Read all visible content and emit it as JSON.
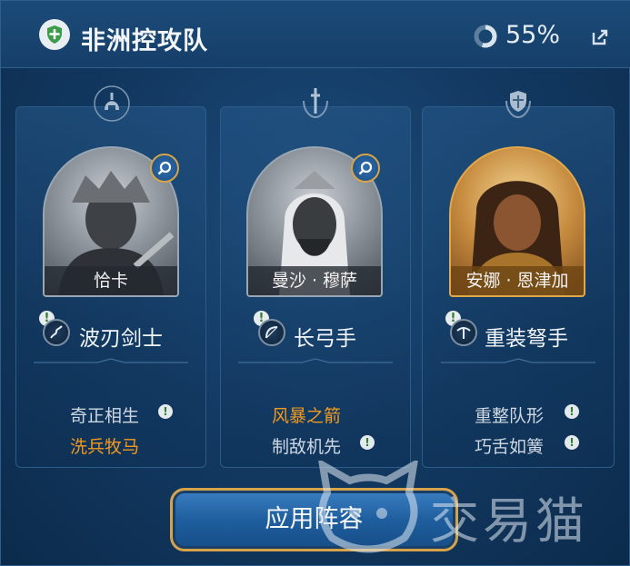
{
  "header": {
    "team_name": "非洲控攻队",
    "progress_text": "55%",
    "progress_fraction": 0.55
  },
  "cards": [
    {
      "hero_name": "恰卡",
      "class_label": "波刃剑士",
      "role_icon": "spartan-helmet-icon",
      "class_icon": "wavy-sword-icon",
      "portrait_style": "grayscale",
      "skills": [
        {
          "text": "奇正相生",
          "color": "white",
          "has_warn": true
        },
        {
          "text": "洗兵牧马",
          "color": "orange",
          "has_warn": false
        }
      ]
    },
    {
      "hero_name": "曼沙 · 穆萨",
      "class_label": "长弓手",
      "role_icon": "sword-wreath-icon",
      "class_icon": "bow-icon",
      "portrait_style": "grayscale",
      "skills": [
        {
          "text": "风暴之箭",
          "color": "orange",
          "has_warn": false
        },
        {
          "text": "制敌机先",
          "color": "white",
          "has_warn": true
        }
      ]
    },
    {
      "hero_name": "安娜 · 恩津加",
      "class_label": "重装弩手",
      "role_icon": "shield-wreath-icon",
      "class_icon": "crossbow-icon",
      "portrait_style": "gold",
      "skills": [
        {
          "text": "重整队形",
          "color": "white",
          "has_warn": true
        },
        {
          "text": "巧舌如簧",
          "color": "white",
          "has_warn": true
        }
      ]
    }
  ],
  "apply_button_label": "应用阵容",
  "watermark_text": "交易猫",
  "colors": {
    "orange_skill": "#f39a1e",
    "gold_border": "#d6a24a",
    "panel_bg": "#133a63"
  }
}
